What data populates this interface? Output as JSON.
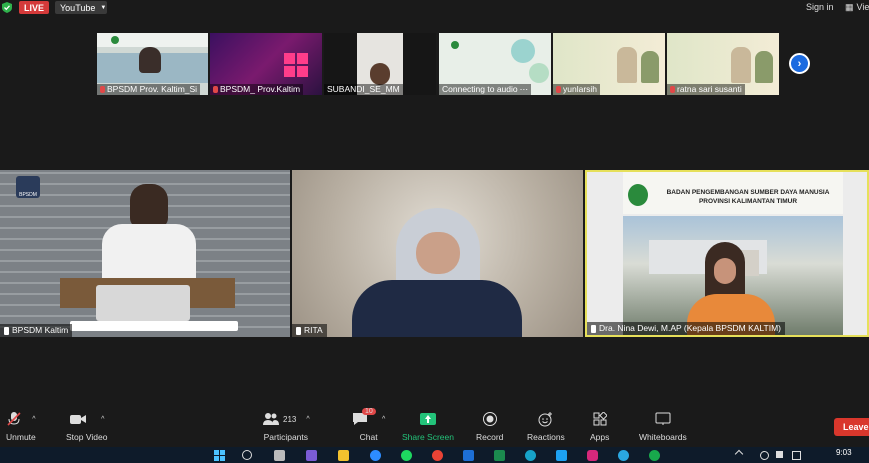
{
  "top": {
    "live_label": "LIVE",
    "stream_label": "YouTube",
    "signin_label": "Sign in",
    "view_label": "Vie"
  },
  "thumbnails": [
    {
      "name": "BPSDM Prov. Kaltim_Si",
      "muted": true
    },
    {
      "name": "BPSDM_ Prov.Kaltim",
      "muted": true
    },
    {
      "name": "SUBANDI_SE_MM",
      "muted": false
    },
    {
      "name": "Connecting to audio",
      "muted": false
    },
    {
      "name": "yunlarsih",
      "muted": true
    },
    {
      "name": "ratna sari susanti",
      "muted": true
    }
  ],
  "tiles": [
    {
      "name": "BPSDM Kaltim",
      "badge": "BPSDM"
    },
    {
      "name": "RITA"
    },
    {
      "name": "Dra. Nina Dewi, M.AP (Kepala BPSDM KALTIM)",
      "banner_line1": "BADAN PENGEMBANGAN SUMBER DAYA MANUSIA",
      "banner_line2": "PROVINSI KALIMANTAN TIMUR"
    }
  ],
  "toolbar": {
    "unmute": "Unmute",
    "stop_video": "Stop Video",
    "participants": "Participants",
    "participants_count": "213",
    "chat": "Chat",
    "chat_badge": "10",
    "share_screen": "Share Screen",
    "record": "Record",
    "reactions": "Reactions",
    "apps": "Apps",
    "whiteboards": "Whiteboards",
    "leave": "Leave"
  },
  "taskbar": {
    "time": "9:03"
  },
  "colors": {
    "live_red": "#d43a3a",
    "share_green": "#23c37a",
    "leave_red": "#d9372c",
    "active_border": "#e6e05a",
    "next_blue": "#1c6be0"
  }
}
